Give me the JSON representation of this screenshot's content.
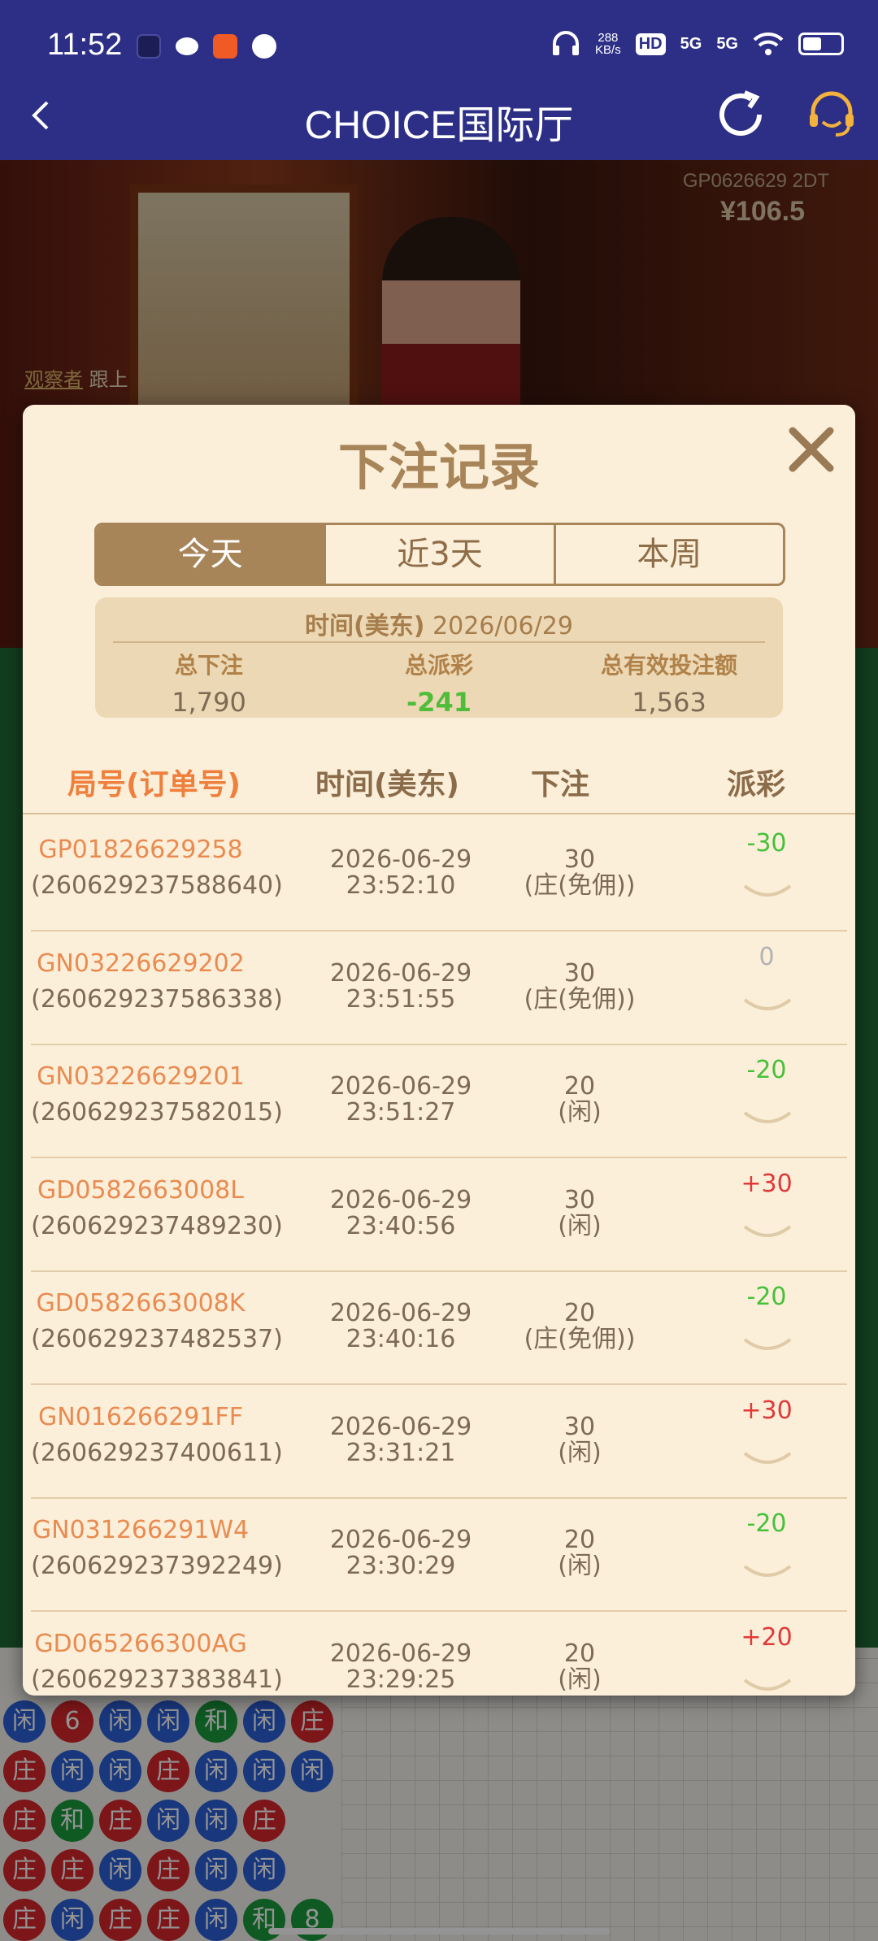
{
  "status_bar": {
    "time": "11:52",
    "net_speed_value": "288",
    "net_speed_unit": "KB/s",
    "hd": "HD",
    "signal1": "5G",
    "signal2": "5G"
  },
  "header": {
    "title": "CHOICE国际厅"
  },
  "background": {
    "table_id": "GP0626629 2DT",
    "balance": "¥106.5",
    "chat_user": "观察者",
    "chat_text": "跟上"
  },
  "modal": {
    "title": "下注记录",
    "tabs": [
      {
        "label": "今天",
        "active": true
      },
      {
        "label": "近3天",
        "active": false
      },
      {
        "label": "本周",
        "active": false
      }
    ],
    "summary": {
      "date_label": "时间(美东)",
      "date": "2026/06/29",
      "total_bet_label": "总下注",
      "total_bet": "1,790",
      "total_payout_label": "总派彩",
      "total_payout": "-241",
      "total_valid_label": "总有效投注额",
      "total_valid": "1,563"
    },
    "columns": {
      "id": "局号(订单号)",
      "time": "时间(美东)",
      "bet": "下注",
      "payout": "派彩"
    },
    "rows": [
      {
        "id": "GP01826629258",
        "order": "(260629237588640)",
        "date": "2026-06-29",
        "time": "23:52:10",
        "amount": "30",
        "side": "(庄(免佣))",
        "payout": "-30"
      },
      {
        "id": "GN03226629202",
        "order": "(260629237586338)",
        "date": "2026-06-29",
        "time": "23:51:55",
        "amount": "30",
        "side": "(庄(免佣))",
        "payout": "0"
      },
      {
        "id": "GN03226629201",
        "order": "(260629237582015)",
        "date": "2026-06-29",
        "time": "23:51:27",
        "amount": "20",
        "side": "(闲)",
        "payout": "-20"
      },
      {
        "id": "GD0582663008L",
        "order": "(260629237489230)",
        "date": "2026-06-29",
        "time": "23:40:56",
        "amount": "30",
        "side": "(闲)",
        "payout": "+30"
      },
      {
        "id": "GD0582663008K",
        "order": "(260629237482537)",
        "date": "2026-06-29",
        "time": "23:40:16",
        "amount": "20",
        "side": "(庄(免佣))",
        "payout": "-20"
      },
      {
        "id": "GN016266291FF",
        "order": "(260629237400611)",
        "date": "2026-06-29",
        "time": "23:31:21",
        "amount": "30",
        "side": "(闲)",
        "payout": "+30"
      },
      {
        "id": "GN031266291W4",
        "order": "(260629237392249)",
        "date": "2026-06-29",
        "time": "23:30:29",
        "amount": "20",
        "side": "(闲)",
        "payout": "-20"
      },
      {
        "id": "GD065266300AG",
        "order": "(260629237383841)",
        "date": "2026-06-29",
        "time": "23:29:25",
        "amount": "20",
        "side": "(闲)",
        "payout": "+20"
      }
    ]
  },
  "bead_road": [
    [
      "闲",
      "6",
      "闲",
      "闲",
      "和",
      "闲",
      "庄"
    ],
    [
      "庄",
      "闲",
      "闲",
      "庄",
      "闲",
      "闲",
      "闲"
    ],
    [
      "庄",
      "和",
      "庄",
      "闲",
      "闲",
      "庄",
      ""
    ],
    [
      "庄",
      "庄",
      "闲",
      "庄",
      "闲",
      "闲",
      ""
    ],
    [
      "庄",
      "闲",
      "庄",
      "庄",
      "闲",
      "和",
      "8"
    ]
  ],
  "colors": {
    "header_bg": "#2d2f86",
    "modal_bg": "#fbefd9",
    "accent": "#a88459",
    "id_orange": "#e98b51",
    "win_green": "#47c03a",
    "win_red": "#e23838"
  }
}
